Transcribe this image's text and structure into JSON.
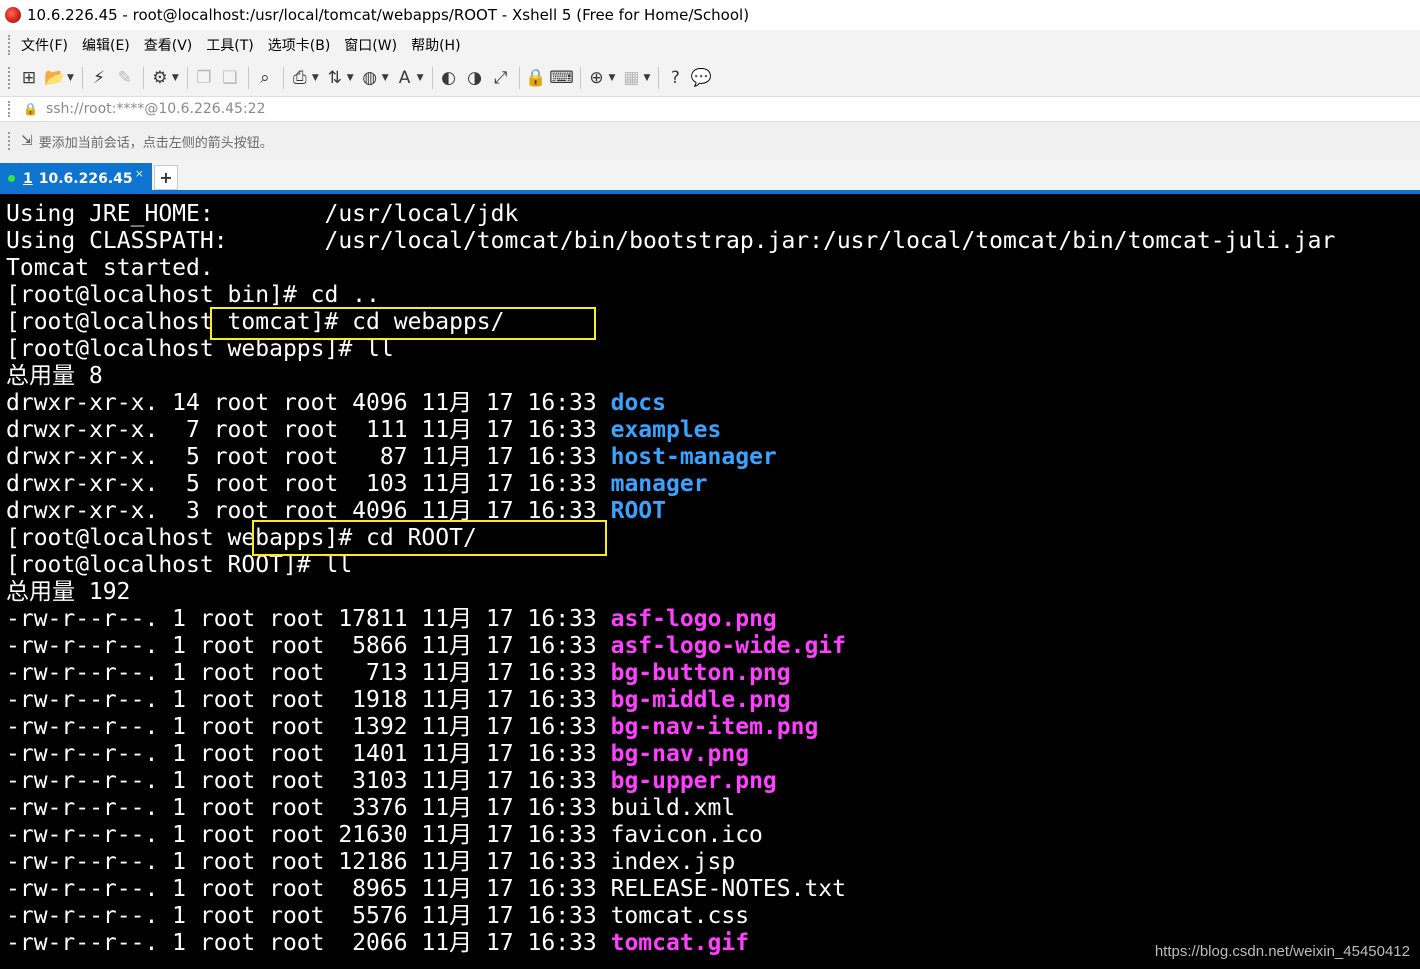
{
  "window": {
    "title": "10.6.226.45  - root@localhost:/usr/local/tomcat/webapps/ROOT - Xshell 5 (Free for Home/School)"
  },
  "menu": {
    "items": [
      "文件(F)",
      "编辑(E)",
      "查看(V)",
      "工具(T)",
      "选项卡(B)",
      "窗口(W)",
      "帮助(H)"
    ]
  },
  "toolbar": {
    "buttons": [
      {
        "icon": "new-session-icon",
        "glyph": "⊞",
        "dropdown": false
      },
      {
        "icon": "open-folder-icon",
        "glyph": "📂",
        "dropdown": true
      },
      {
        "icon": "connect-icon",
        "glyph": "⚡",
        "dropdown": false
      },
      {
        "icon": "disconnect-icon",
        "glyph": "✎",
        "dropdown": false,
        "disabled": true
      },
      {
        "icon": "properties-icon",
        "glyph": "⚙",
        "dropdown": true
      },
      {
        "icon": "copy-icon",
        "glyph": "❐",
        "dropdown": false,
        "disabled": true
      },
      {
        "icon": "paste-icon",
        "glyph": "❏",
        "dropdown": false,
        "disabled": true
      },
      {
        "icon": "find-icon",
        "glyph": "⌕",
        "dropdown": false
      },
      {
        "icon": "print-icon",
        "glyph": "⎙",
        "dropdown": true
      },
      {
        "icon": "transfer-icon",
        "glyph": "⇅",
        "dropdown": true
      },
      {
        "icon": "globe-icon",
        "glyph": "◍",
        "dropdown": true
      },
      {
        "icon": "font-icon",
        "glyph": "A",
        "dropdown": true
      },
      {
        "icon": "xftp-icon",
        "glyph": "◐",
        "dropdown": false
      },
      {
        "icon": "xmanager-icon",
        "glyph": "◑",
        "dropdown": false
      },
      {
        "icon": "fullscreen-icon",
        "glyph": "⤢",
        "dropdown": false
      },
      {
        "icon": "lock-icon",
        "glyph": "🔒",
        "dropdown": false
      },
      {
        "icon": "keyboard-icon",
        "glyph": "⌨",
        "dropdown": false
      },
      {
        "icon": "add-tab-icon",
        "glyph": "⊕",
        "dropdown": true
      },
      {
        "icon": "layout-icon",
        "glyph": "▦",
        "dropdown": true,
        "disabled": true
      },
      {
        "icon": "help-icon",
        "glyph": "?",
        "dropdown": false
      },
      {
        "icon": "chat-icon",
        "glyph": "💬",
        "dropdown": false,
        "disabled": true
      }
    ]
  },
  "address": {
    "text": "ssh://root:****@10.6.226.45:22"
  },
  "hint": {
    "text": "要添加当前会话，点击左侧的箭头按钮。"
  },
  "tabs": {
    "active": {
      "number": "1",
      "label": "10.6.226.45",
      "close": "×"
    },
    "add_label": "+"
  },
  "terminal": {
    "lines": [
      [
        {
          "t": "Using JRE_HOME:        /usr/local/jdk",
          "c": "plain"
        }
      ],
      [
        {
          "t": "Using CLASSPATH:       /usr/local/tomcat/bin/bootstrap.jar:/usr/local/tomcat/bin/tomcat-juli.jar",
          "c": "plain"
        }
      ],
      [
        {
          "t": "Tomcat started.",
          "c": "plain"
        }
      ],
      [
        {
          "t": "[root@localhost bin]# cd ..",
          "c": "plain"
        }
      ],
      [
        {
          "t": "[root@localhost tomcat]# cd webapps/",
          "c": "plain"
        }
      ],
      [
        {
          "t": "[root@localhost webapps]# ll",
          "c": "plain"
        }
      ],
      [
        {
          "t": "总用量 8",
          "c": "plain"
        }
      ],
      [
        {
          "t": "drwxr-xr-x. 14 root root 4096 11月 17 16:33 ",
          "c": "plain"
        },
        {
          "t": "docs",
          "c": "dir"
        }
      ],
      [
        {
          "t": "drwxr-xr-x.  7 root root  111 11月 17 16:33 ",
          "c": "plain"
        },
        {
          "t": "examples",
          "c": "dir"
        }
      ],
      [
        {
          "t": "drwxr-xr-x.  5 root root   87 11月 17 16:33 ",
          "c": "plain"
        },
        {
          "t": "host-manager",
          "c": "dir"
        }
      ],
      [
        {
          "t": "drwxr-xr-x.  5 root root  103 11月 17 16:33 ",
          "c": "plain"
        },
        {
          "t": "manager",
          "c": "dir"
        }
      ],
      [
        {
          "t": "drwxr-xr-x.  3 root root 4096 11月 17 16:33 ",
          "c": "plain"
        },
        {
          "t": "ROOT",
          "c": "dir"
        }
      ],
      [
        {
          "t": "[root@localhost webapps]# cd ROOT/",
          "c": "plain"
        }
      ],
      [
        {
          "t": "[root@localhost ROOT]# ll",
          "c": "plain"
        }
      ],
      [
        {
          "t": "总用量 192",
          "c": "plain"
        }
      ],
      [
        {
          "t": "-rw-r--r--. 1 root root 17811 11月 17 16:33 ",
          "c": "plain"
        },
        {
          "t": "asf-logo.png",
          "c": "img"
        }
      ],
      [
        {
          "t": "-rw-r--r--. 1 root root  5866 11月 17 16:33 ",
          "c": "plain"
        },
        {
          "t": "asf-logo-wide.gif",
          "c": "img"
        }
      ],
      [
        {
          "t": "-rw-r--r--. 1 root root   713 11月 17 16:33 ",
          "c": "plain"
        },
        {
          "t": "bg-button.png",
          "c": "img"
        }
      ],
      [
        {
          "t": "-rw-r--r--. 1 root root  1918 11月 17 16:33 ",
          "c": "plain"
        },
        {
          "t": "bg-middle.png",
          "c": "img"
        }
      ],
      [
        {
          "t": "-rw-r--r--. 1 root root  1392 11月 17 16:33 ",
          "c": "plain"
        },
        {
          "t": "bg-nav-item.png",
          "c": "img"
        }
      ],
      [
        {
          "t": "-rw-r--r--. 1 root root  1401 11月 17 16:33 ",
          "c": "plain"
        },
        {
          "t": "bg-nav.png",
          "c": "img"
        }
      ],
      [
        {
          "t": "-rw-r--r--. 1 root root  3103 11月 17 16:33 ",
          "c": "plain"
        },
        {
          "t": "bg-upper.png",
          "c": "img"
        }
      ],
      [
        {
          "t": "-rw-r--r--. 1 root root  3376 11月 17 16:33 build.xml",
          "c": "plain"
        }
      ],
      [
        {
          "t": "-rw-r--r--. 1 root root 21630 11月 17 16:33 favicon.ico",
          "c": "plain"
        }
      ],
      [
        {
          "t": "-rw-r--r--. 1 root root 12186 11月 17 16:33 index.jsp",
          "c": "plain"
        }
      ],
      [
        {
          "t": "-rw-r--r--. 1 root root  8965 11月 17 16:33 RELEASE-NOTES.txt",
          "c": "plain"
        }
      ],
      [
        {
          "t": "-rw-r--r--. 1 root root  5576 11月 17 16:33 tomcat.css",
          "c": "plain"
        }
      ],
      [
        {
          "t": "-rw-r--r--. 1 root root  2066 11月 17 16:33 ",
          "c": "plain"
        },
        {
          "t": "tomcat.gif",
          "c": "img"
        }
      ]
    ]
  },
  "watermark": "https://blog.csdn.net/weixin_45450412",
  "colors": {
    "tab_accent": "#0f74d0",
    "directory": "#3aa3ff",
    "image_file": "#ff40ff",
    "highlight_box": "#f7ee1a",
    "terminal_bg": "#000000"
  }
}
